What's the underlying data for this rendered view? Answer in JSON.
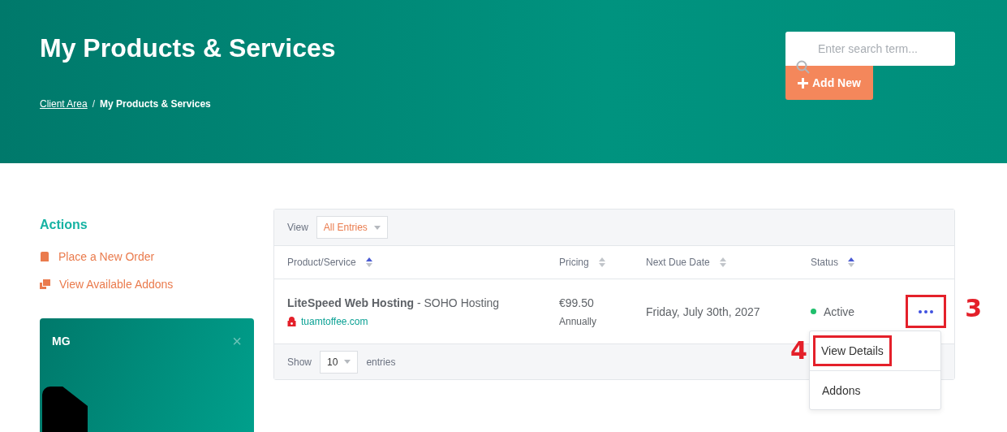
{
  "header": {
    "title": "My Products & Services",
    "search": {
      "placeholder": "Enter search term..."
    },
    "add_button": "Add New",
    "breadcrumb_separator": "/",
    "breadcrumb": [
      {
        "label": "Client Area",
        "link": true
      },
      {
        "label": "My Products & Services",
        "link": false
      }
    ]
  },
  "sidebar": {
    "heading": "Actions",
    "items": [
      {
        "kind": "order",
        "label": "Place a New Order"
      },
      {
        "kind": "addons",
        "label": "View Available Addons"
      }
    ],
    "promo": {
      "title": "MG",
      "close": "×"
    }
  },
  "table": {
    "view_label": "View",
    "view_select": "All Entries",
    "columns": [
      {
        "label": "Product/Service",
        "sorted": true
      },
      {
        "label": "Pricing",
        "sorted": false
      },
      {
        "label": "Next Due Date",
        "sorted": false
      },
      {
        "label": "Status",
        "sorted": true
      }
    ],
    "rows": [
      {
        "product": "LiteSpeed Web Hosting",
        "plan": " - SOHO Hosting",
        "domain": "tuamtoffee.com",
        "price": "€99.50",
        "cycle": "Annually",
        "due": "Friday, July 30th, 2027",
        "status": "Active",
        "color": "#1fbf6c",
        "more_highlighted": true,
        "menu": [
          {
            "label": "View Details",
            "highlighted": true
          },
          {
            "label": "Addons",
            "highlighted": false
          }
        ]
      }
    ],
    "show_label": "Show",
    "show_select": "10",
    "entries_label": "entries"
  },
  "annotations": [
    {
      "label": "3"
    },
    {
      "label": "4"
    }
  ]
}
